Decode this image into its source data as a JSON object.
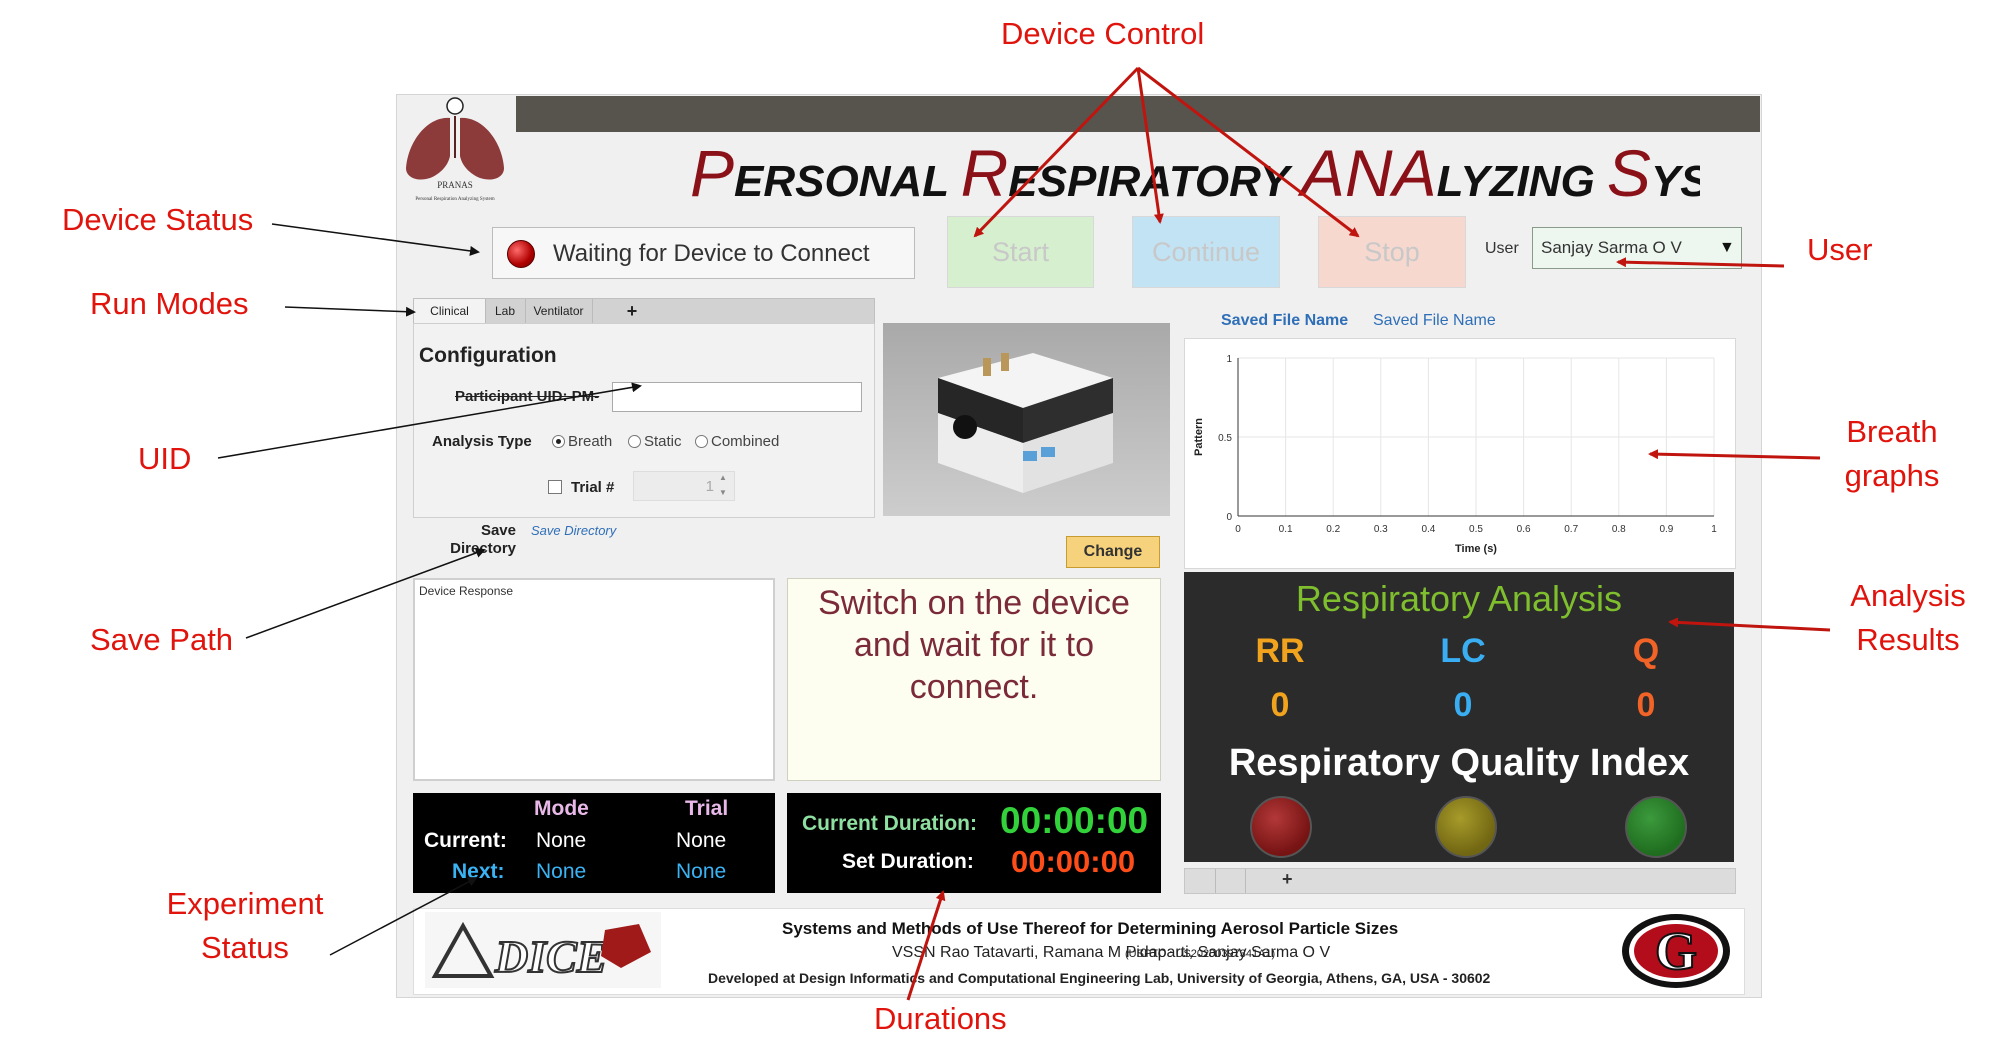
{
  "app": {
    "title_parts": [
      "P",
      "ERSONAL ",
      "R",
      "ESPIRATORY ",
      "ANA",
      "LYZING ",
      "S",
      "YSTEM"
    ],
    "logo_text": "PRANAS",
    "logo_subtext": "Personal Respiration Analyzing System"
  },
  "status": {
    "text": "Waiting for Device to Connect"
  },
  "controls": {
    "start": "Start",
    "continue": "Continue",
    "stop": "Stop"
  },
  "user": {
    "label": "User",
    "selected": "Sanjay Sarma O V"
  },
  "tabs": {
    "clinical": "Clinical",
    "lab": "Lab",
    "ventilator": "Ventilator",
    "add": "+"
  },
  "config": {
    "title": "Configuration",
    "uid_label": "Participant UID: PM-",
    "uid_value": "",
    "analysis_label": "Analysis Type",
    "options": [
      "Breath",
      "Static",
      "Combined"
    ],
    "selected_option": "Breath",
    "trial_label": "Trial #",
    "trial_value": "1"
  },
  "save": {
    "label": "Save Directory",
    "path": "Save Directory",
    "change": "Change"
  },
  "device_response": {
    "label": "Device Response"
  },
  "message": {
    "text": "Switch on the device and wait for it to connect."
  },
  "experiment": {
    "mode_header": "Mode",
    "trial_header": "Trial",
    "current_label": "Current:",
    "current_mode": "None",
    "current_trial": "None",
    "next_label": "Next:",
    "next_mode": "None",
    "next_trial": "None"
  },
  "durations": {
    "current_label": "Current Duration:",
    "current_value": "00:00:00",
    "set_label": "Set Duration:",
    "set_value": "00:00:00"
  },
  "graph": {
    "saved_file_label": "Saved File Name",
    "saved_file_value": "Saved File Name"
  },
  "chart_data": {
    "type": "line",
    "series": [],
    "xlabel": "Time (s)",
    "ylabel": "Pattern",
    "xlim": [
      0,
      1
    ],
    "ylim": [
      0,
      1
    ],
    "xticks": [
      "0",
      "0.1",
      "0.2",
      "0.3",
      "0.4",
      "0.5",
      "0.6",
      "0.7",
      "0.8",
      "0.9",
      "1"
    ],
    "yticks": [
      "0",
      "0.5",
      "1"
    ],
    "grid": true
  },
  "analysis": {
    "title": "Respiratory Analysis",
    "rr_label": "RR",
    "rr_value": "0",
    "lc_label": "LC",
    "lc_value": "0",
    "q_label": "Q",
    "q_value": "0",
    "rqi_title": "Respiratory Quality Index",
    "lamp_colors": [
      "#8b1a1a",
      "#8a7f1a",
      "#2a8a2a"
    ],
    "add_tab": "+"
  },
  "footer": {
    "line1": "Systems and Methods of Use Thereof for Determining Aerosol Particle Sizes",
    "line2": "VSSN Rao Tatavarti, Ramana M Pidaparti, Sanjay Sarma O V",
    "patent": "(USPTO : US20200397341A1)",
    "line3": "Developed at Design Informatics and Computational Engineering Lab, University of Georgia, Athens, GA, USA - 30602",
    "dice_logo": "DICE",
    "uga_logo": "G"
  },
  "annotations": {
    "device_control": "Device Control",
    "device_status": "Device Status",
    "run_modes": "Run Modes",
    "uid": "UID",
    "save_path": "Save Path",
    "experiment_status": [
      "Experiment",
      "Status"
    ],
    "durations": "Durations",
    "user": "User",
    "breath_graphs": [
      "Breath",
      "graphs"
    ],
    "analysis_results": [
      "Analysis",
      "Results"
    ]
  }
}
